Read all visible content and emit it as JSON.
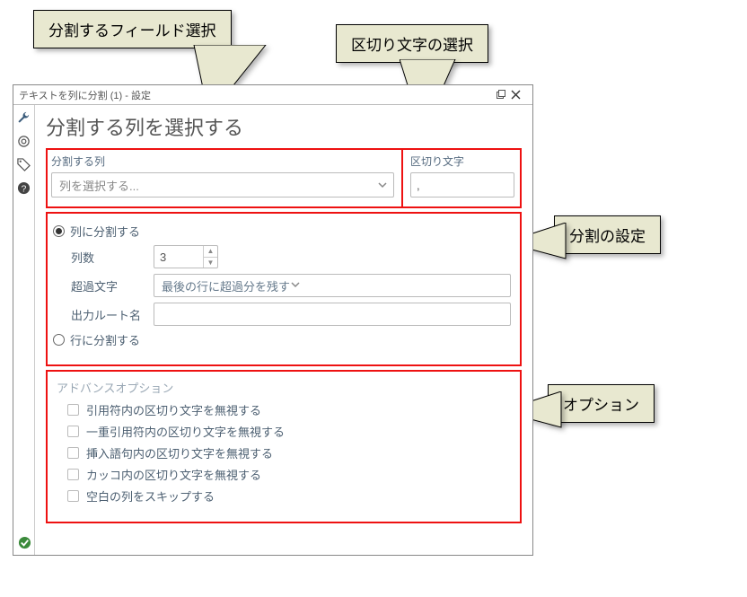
{
  "callouts": {
    "field": "分割するフィールド選択",
    "delim": "区切り文字の選択",
    "split": "分割の設定",
    "options": "オプション"
  },
  "window": {
    "title": "テキストを列に分割 (1) - 設定"
  },
  "heading": "分割する列を選択する",
  "splitCol": {
    "label": "分割する列",
    "placeholder": "列を選択する..."
  },
  "delimiter": {
    "label": "区切り文字",
    "value": ","
  },
  "splitSettings": {
    "radioCols": "列に分割する",
    "radioRows": "行に分割する",
    "numLabel": "列数",
    "numValue": "3",
    "overflowLabel": "超過文字",
    "overflowValue": "最後の行に超過分を残す",
    "rootLabel": "出力ルート名"
  },
  "advanced": {
    "title": "アドバンスオプション",
    "opts": [
      "引用符内の区切り文字を無視する",
      "一重引用符内の区切り文字を無視する",
      "挿入語句内の区切り文字を無視する",
      "カッコ内の区切り文字を無視する",
      "空白の列をスキップする"
    ]
  }
}
